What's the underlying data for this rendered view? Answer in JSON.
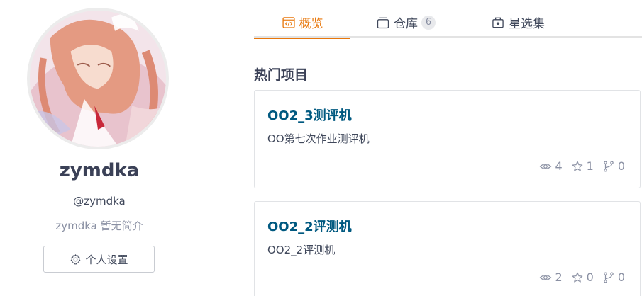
{
  "profile": {
    "username": "zymdka",
    "handle": "@zymdka",
    "bio": "zymdka 暂无简介",
    "settings_label": "个人设置",
    "settings_icon": "gear-icon"
  },
  "tabs": [
    {
      "label": "概览",
      "icon": "code-window-icon",
      "active": true
    },
    {
      "label": "仓库",
      "icon": "repo-icon",
      "count": "6"
    },
    {
      "label": "星选集",
      "icon": "star-collection-icon"
    }
  ],
  "section": {
    "title": "热门项目"
  },
  "projects": [
    {
      "name": "OO2_3测评机",
      "description": "OO第七次作业测评机",
      "watches": "4",
      "stars": "1",
      "forks": "0"
    },
    {
      "name": "OO2_2评测机",
      "description": "OO2_2评测机",
      "watches": "2",
      "stars": "0",
      "forks": "0"
    }
  ],
  "colors": {
    "accent": "#e8770b",
    "link": "#005980",
    "muted": "#8a90a3"
  }
}
